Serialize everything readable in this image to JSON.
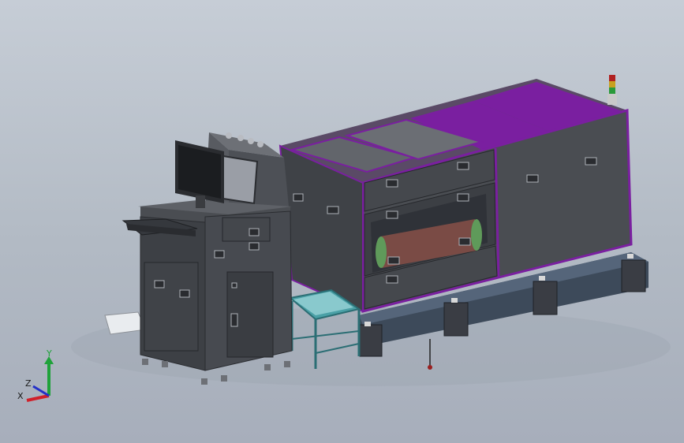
{
  "viewport": {
    "background_top": "#c6cdd6",
    "background_bottom": "#a7aebb"
  },
  "model": {
    "name": "",
    "body_color": "#4a4d52",
    "accent_color": "#7a1fa0",
    "frame_color": "#2f3138",
    "base_color": "#3d4a5a",
    "roller_color": "#7a4b45"
  },
  "triad": {
    "x_label": "X",
    "y_label": "Y",
    "z_label": "Z",
    "x_color": "#d0202a",
    "y_color": "#1fa23a",
    "z_color": "#2330c8"
  },
  "icons": {
    "signal_tower": "signal-tower-icon",
    "triad": "axis-triad-icon"
  }
}
